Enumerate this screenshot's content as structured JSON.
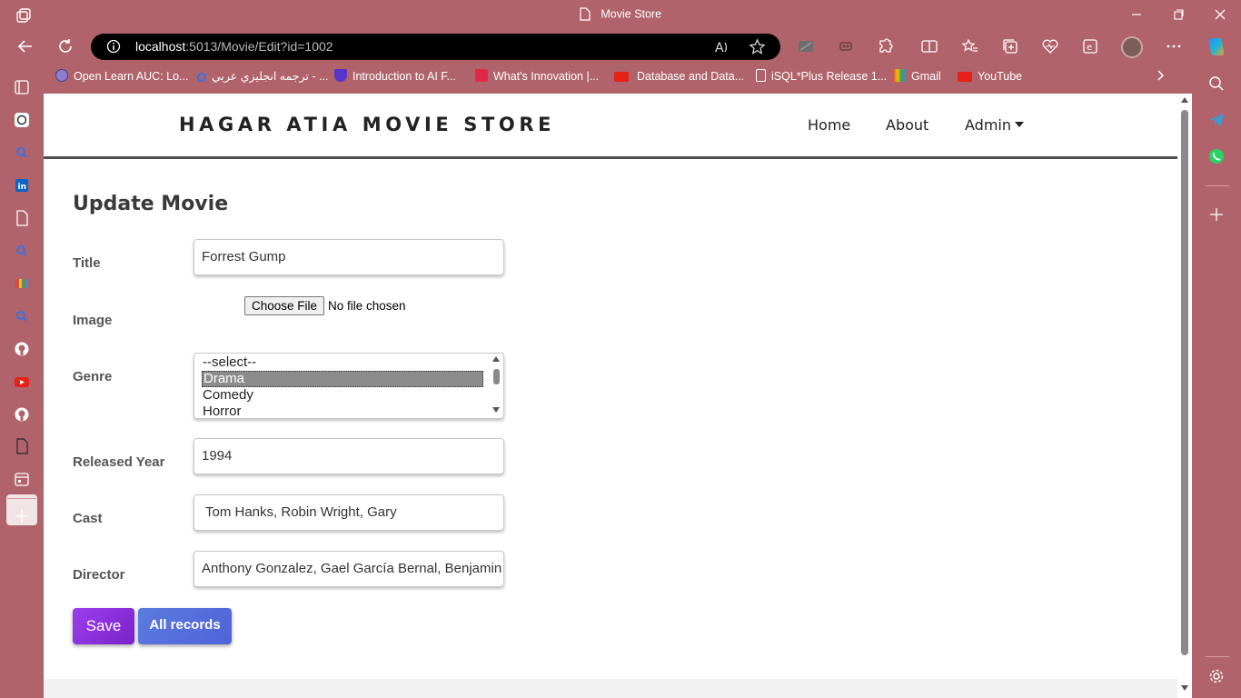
{
  "window": {
    "tab_title": "Movie Store"
  },
  "address_bar": {
    "host": "localhost",
    "path": ":5013/Movie/Edit?id=1002"
  },
  "favorites": [
    {
      "label": "Open Learn AUC: Lo...",
      "icon": "globe-icon"
    },
    {
      "label": "ترجمه انجليزي عربي - ...",
      "icon": "search-icon"
    },
    {
      "label": "Introduction to AI F...",
      "icon": "udemy-icon"
    },
    {
      "label": "What's Innovation |...",
      "icon": "flag-icon"
    },
    {
      "label": "Database and Data...",
      "icon": "youtube-icon"
    },
    {
      "label": "iSQL*Plus Release 1...",
      "icon": "document-icon"
    },
    {
      "label": "Gmail",
      "icon": "google-icon"
    },
    {
      "label": "YouTube",
      "icon": "youtube-icon"
    }
  ],
  "site": {
    "brand": "HAGAR ATIA MOVIE STORE",
    "nav": {
      "home": "Home",
      "about": "About",
      "admin": "Admin"
    }
  },
  "form": {
    "heading": "Update Movie",
    "labels": {
      "title": "Title",
      "image": "Image",
      "genre": "Genre",
      "released_year": "Released Year",
      "cast": "Cast",
      "director": "Director"
    },
    "values": {
      "title": "Forrest Gump",
      "released_year": "1994",
      "cast": "Tom Hanks, Robin Wright, Gary",
      "director": "Anthony Gonzalez, Gael García Bernal, Benjamin"
    },
    "file": {
      "button": "Choose File",
      "status": "No file chosen"
    },
    "genre_options": [
      "--select--",
      "Drama",
      "Comedy",
      "Horror"
    ],
    "genre_selected": "Drama",
    "buttons": {
      "save": "Save",
      "all_records": "All records"
    }
  },
  "colors": {
    "browser_chrome": "#b0636b",
    "save_button": "#8a2fe0",
    "all_records_button": "#5470dc"
  }
}
